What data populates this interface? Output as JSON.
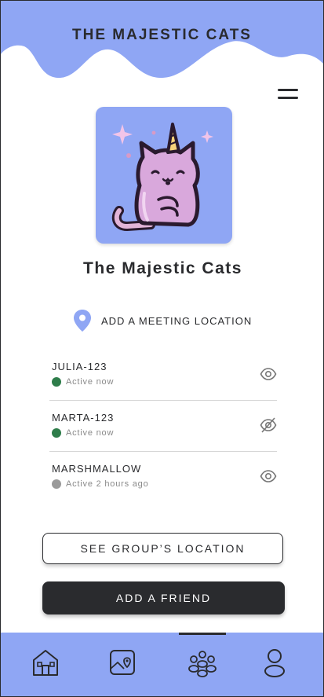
{
  "app": {
    "title": "THE MAJESTIC CATS"
  },
  "group": {
    "name": "The Majestic Cats",
    "avatar": "unicorn-cat-illustration"
  },
  "location": {
    "label": "ADD A MEETING LOCATION",
    "icon": "map-pin-icon"
  },
  "members": [
    {
      "name": "JULIA-123",
      "status": "Active now",
      "status_color": "#2e7d4a",
      "visibility_icon": "eye-icon"
    },
    {
      "name": "MARTA-123",
      "status": "Active now",
      "status_color": "#2e7d4a",
      "visibility_icon": "eye-off-icon"
    },
    {
      "name": "MARSHMALLOW",
      "status": "Active 2 hours ago",
      "status_color": "#9a9a9a",
      "visibility_icon": "eye-icon"
    }
  ],
  "actions": {
    "see_location": "SEE GROUP’S LOCATION",
    "add_friend": "ADD A FRIEND"
  },
  "nav": {
    "items": [
      "home-icon",
      "map-icon",
      "group-icon",
      "profile-icon"
    ],
    "active_index": 2
  },
  "colors": {
    "accent": "#8fa6f4",
    "dark": "#2a2b2e",
    "online": "#2e7d4a",
    "offline": "#9a9a9a"
  }
}
